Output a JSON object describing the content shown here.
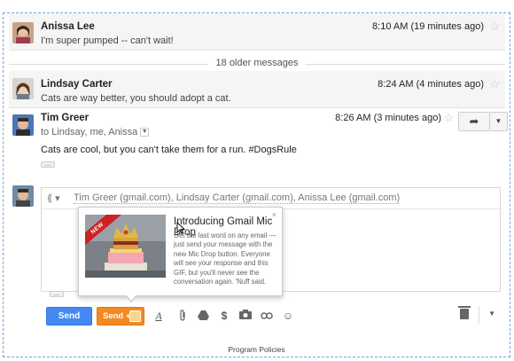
{
  "messages": [
    {
      "sender": "Anissa Lee",
      "snippet": "I'm super pumped -- can't wait!",
      "time": "8:10 AM (19 minutes ago)"
    },
    {
      "sender": "Lindsay Carter",
      "snippet": "Cats are way better, you should adopt a cat.",
      "time": "8:24 AM (4 minutes ago)"
    },
    {
      "sender": "Tim Greer",
      "recipients": "to Lindsay, me, Anissa",
      "body": "Cats are cool, but you can't take them for a run. #DogsRule",
      "time": "8:26 AM (3 minutes ago)"
    }
  ],
  "older_messages": "18 older messages",
  "compose": {
    "to": "Tim Greer (gmail.com), Lindsay Carter (gmail.com), Anissa Lee (gmail.com)"
  },
  "popup": {
    "ribbon": "NEW",
    "title": "Introducing Gmail Mic Drop",
    "body": "Get the last word on any email — just send your message with the new Mic Drop button. Everyone will see your response and this GIF, but you'll never see the conversation again. 'Nuff said.",
    "close": "×"
  },
  "toolbar": {
    "send": "Send",
    "send_plus": "Send +",
    "icons": [
      "format-icon",
      "attach-icon",
      "drive-icon",
      "money-icon",
      "photo-icon",
      "link-icon",
      "emoji-icon",
      "trash-icon",
      "more-options-icon"
    ]
  },
  "footer": "Program Policies",
  "colors": {
    "send": "#4688f1",
    "send_plus": "#f4891f",
    "ribbon": "#cc2222",
    "frame_border": "#7aa3d6"
  }
}
